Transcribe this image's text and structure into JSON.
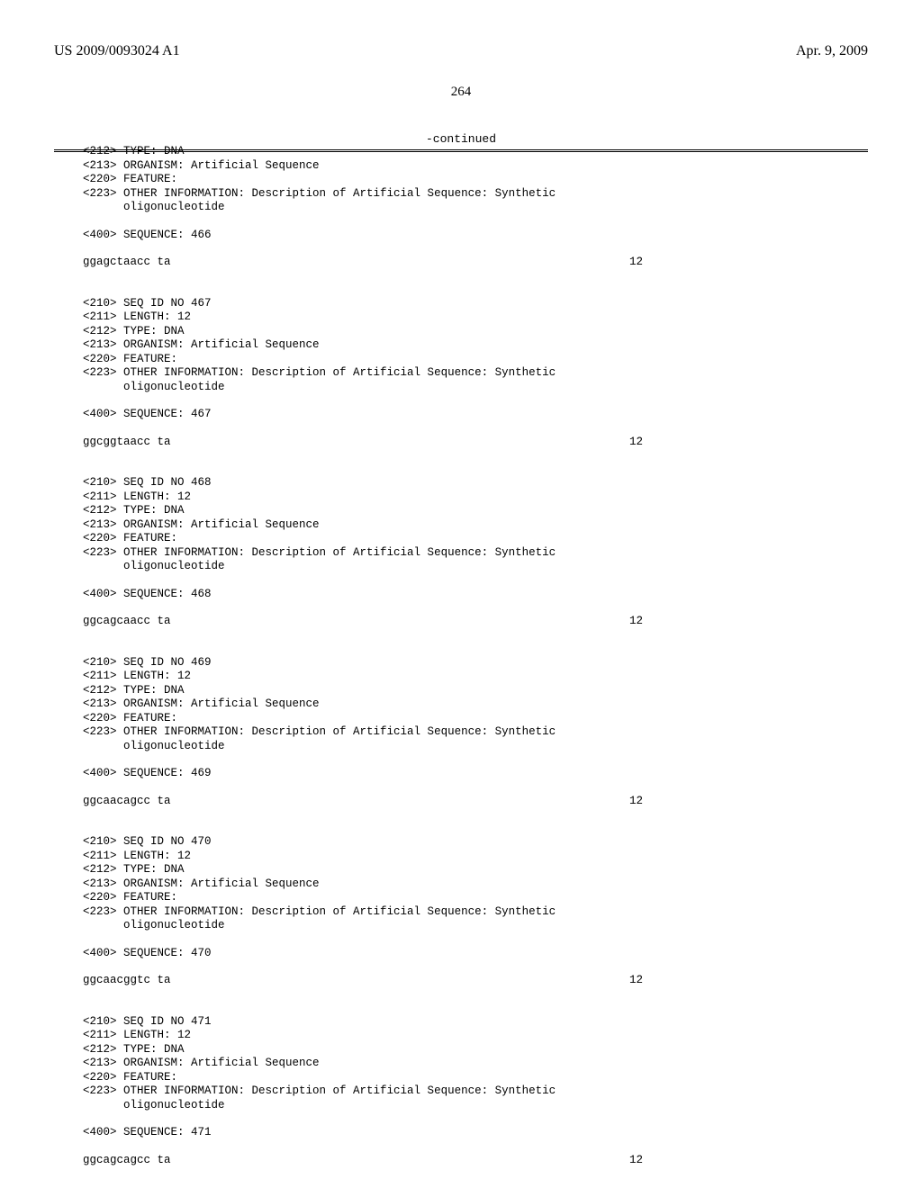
{
  "header": {
    "left": "US 2009/0093024 A1",
    "right": "Apr. 9, 2009"
  },
  "page_number": "264",
  "continued_label": "-continued",
  "prefix_block": [
    "<212> TYPE: DNA",
    "<213> ORGANISM: Artificial Sequence",
    "<220> FEATURE:",
    "<223> OTHER INFORMATION: Description of Artificial Sequence: Synthetic",
    "      oligonucleotide",
    "",
    "<400> SEQUENCE: 466",
    ""
  ],
  "prefix_sequence": {
    "seq": "ggagctaacc ta",
    "count": "12"
  },
  "entries": [
    {
      "lines": [
        "<210> SEQ ID NO 467",
        "<211> LENGTH: 12",
        "<212> TYPE: DNA",
        "<213> ORGANISM: Artificial Sequence",
        "<220> FEATURE:",
        "<223> OTHER INFORMATION: Description of Artificial Sequence: Synthetic",
        "      oligonucleotide",
        "",
        "<400> SEQUENCE: 467",
        ""
      ],
      "sequence": {
        "seq": "ggcggtaacc ta",
        "count": "12"
      }
    },
    {
      "lines": [
        "<210> SEQ ID NO 468",
        "<211> LENGTH: 12",
        "<212> TYPE: DNA",
        "<213> ORGANISM: Artificial Sequence",
        "<220> FEATURE:",
        "<223> OTHER INFORMATION: Description of Artificial Sequence: Synthetic",
        "      oligonucleotide",
        "",
        "<400> SEQUENCE: 468",
        ""
      ],
      "sequence": {
        "seq": "ggcagcaacc ta",
        "count": "12"
      }
    },
    {
      "lines": [
        "<210> SEQ ID NO 469",
        "<211> LENGTH: 12",
        "<212> TYPE: DNA",
        "<213> ORGANISM: Artificial Sequence",
        "<220> FEATURE:",
        "<223> OTHER INFORMATION: Description of Artificial Sequence: Synthetic",
        "      oligonucleotide",
        "",
        "<400> SEQUENCE: 469",
        ""
      ],
      "sequence": {
        "seq": "ggcaacagcc ta",
        "count": "12"
      }
    },
    {
      "lines": [
        "<210> SEQ ID NO 470",
        "<211> LENGTH: 12",
        "<212> TYPE: DNA",
        "<213> ORGANISM: Artificial Sequence",
        "<220> FEATURE:",
        "<223> OTHER INFORMATION: Description of Artificial Sequence: Synthetic",
        "      oligonucleotide",
        "",
        "<400> SEQUENCE: 470",
        ""
      ],
      "sequence": {
        "seq": "ggcaacggtc ta",
        "count": "12"
      }
    },
    {
      "lines": [
        "<210> SEQ ID NO 471",
        "<211> LENGTH: 12",
        "<212> TYPE: DNA",
        "<213> ORGANISM: Artificial Sequence",
        "<220> FEATURE:",
        "<223> OTHER INFORMATION: Description of Artificial Sequence: Synthetic",
        "      oligonucleotide",
        "",
        "<400> SEQUENCE: 471",
        ""
      ],
      "sequence": {
        "seq": "ggcagcagcc ta",
        "count": "12"
      }
    }
  ]
}
